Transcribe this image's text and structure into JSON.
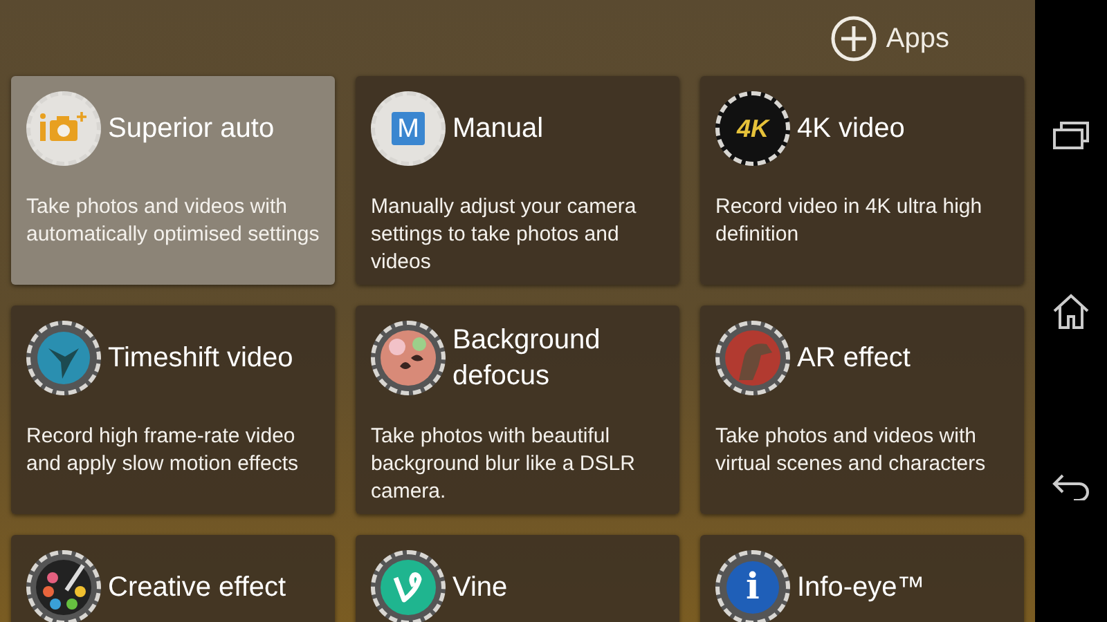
{
  "header": {
    "apps_label": "Apps"
  },
  "modes": [
    {
      "kind": "superior",
      "title": "Superior auto",
      "description": "Take photos and videos with automatically optimised settings",
      "selected": true
    },
    {
      "kind": "manual",
      "icon_text": "M",
      "title": "Manual",
      "description": "Manually adjust your camera settings to take photos and videos",
      "selected": false
    },
    {
      "kind": "fourk",
      "icon_text": "4K",
      "title": "4K video",
      "description": "Record video in 4K ultra high definition",
      "selected": false
    },
    {
      "kind": "timeshift",
      "title": "Timeshift video",
      "description": "Record high frame-rate video and apply slow motion effects",
      "selected": false
    },
    {
      "kind": "defocus",
      "title": "Background defocus",
      "description": "Take photos with beautiful background blur like a DSLR camera.",
      "selected": false
    },
    {
      "kind": "ar",
      "title": "AR effect",
      "description": "Take photos and videos with virtual scenes and characters",
      "selected": false
    },
    {
      "kind": "creative",
      "title": "Creative effect",
      "selected": false
    },
    {
      "kind": "vine",
      "title": "Vine",
      "selected": false
    },
    {
      "kind": "info",
      "icon_text": "i",
      "title": "Info-eye™",
      "selected": false
    }
  ]
}
